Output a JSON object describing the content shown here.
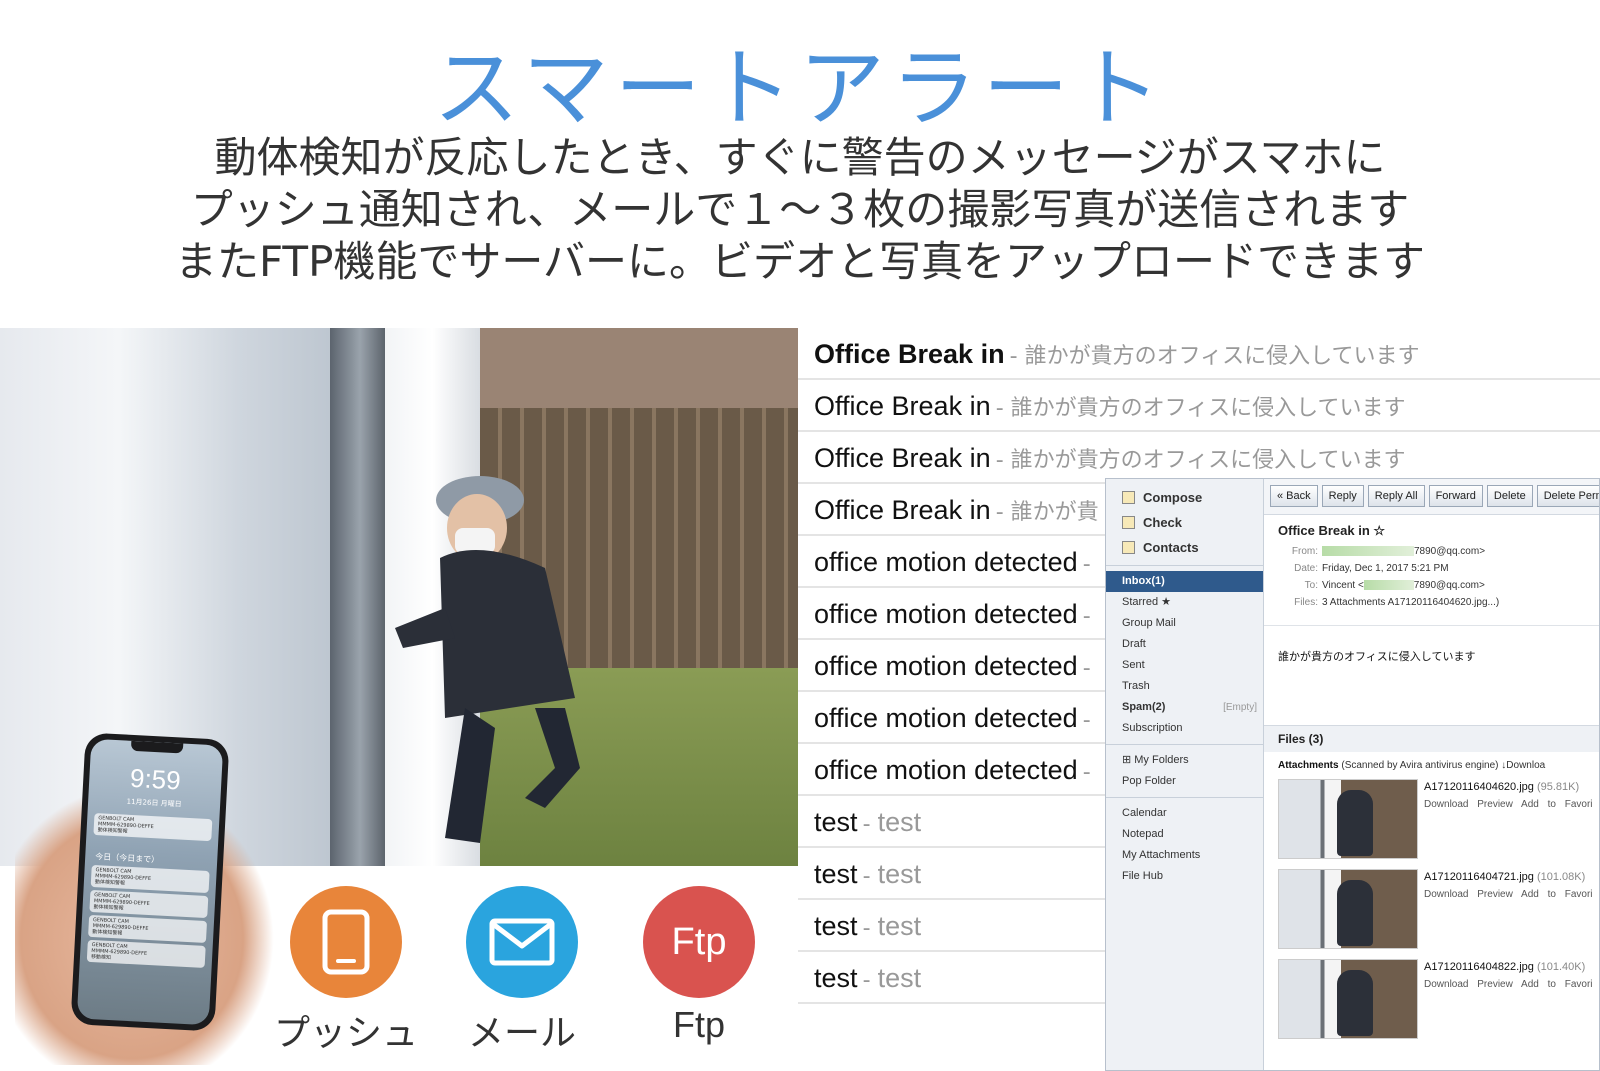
{
  "title": "スマートアラート",
  "description": [
    "動体検知が反応したとき、すぐに警告のメッセージがスマホに",
    "プッシュ通知され、メールで１～３枚の撮影写真が送信されます",
    "またFTP機能でサーバーに。ビデオと写真をアップロードできます"
  ],
  "phone": {
    "time": "9:59",
    "date": "11月26日 月曜日",
    "today_label": "今日（今日まで）",
    "notifications": [
      {
        "app": "GENBOLT CAM",
        "text": "MMMM-629890-DEFFE",
        "sub": "動体検知警報"
      },
      {
        "app": "GENBOLT CAM",
        "text": "MMMM-629890-DEFFE",
        "sub": "動体検知警報"
      },
      {
        "app": "GENBOLT CAM",
        "text": "MMMM-629890-DEFFE",
        "sub": "動体検知警報"
      },
      {
        "app": "GENBOLT CAM",
        "text": "MMMM-629890-DEFFE",
        "sub": "動体検知警報"
      },
      {
        "app": "GENBOLT CAM",
        "text": "MMMM-629890-DEFFE",
        "sub": "移動検知"
      }
    ]
  },
  "icons": {
    "push_label": "プッシュ",
    "mail_label": "メール",
    "ftp_label": "Ftp",
    "ftp_text": "Ftp"
  },
  "email_list": [
    {
      "subject": "Office Break in",
      "snippet": "誰かが貴方のオフィスに侵入しています",
      "bold": true
    },
    {
      "subject": "Office Break in",
      "snippet": "誰かが貴方のオフィスに侵入しています",
      "bold": false
    },
    {
      "subject": "Office Break in",
      "snippet": "誰かが貴方のオフィスに侵入しています",
      "bold": false
    },
    {
      "subject": "Office Break in",
      "snippet": "誰かが貴",
      "bold": false
    },
    {
      "subject": "office motion detected",
      "snippet": "",
      "bold": false
    },
    {
      "subject": "office motion detected",
      "snippet": "",
      "bold": false
    },
    {
      "subject": "office motion detected",
      "snippet": "",
      "bold": false
    },
    {
      "subject": "office motion detected",
      "snippet": "",
      "bold": false
    },
    {
      "subject": "office motion detected",
      "snippet": "",
      "bold": false
    },
    {
      "subject": "test",
      "snippet": "test",
      "bold": false
    },
    {
      "subject": "test",
      "snippet": "test",
      "bold": false
    },
    {
      "subject": "test",
      "snippet": "test",
      "bold": false
    },
    {
      "subject": "test",
      "snippet": "test",
      "bold": false
    }
  ],
  "webmail": {
    "actions": [
      {
        "label": "Compose",
        "icon": "compose-icon"
      },
      {
        "label": "Check",
        "icon": "check-icon"
      },
      {
        "label": "Contacts",
        "icon": "contacts-icon"
      }
    ],
    "folders_primary": [
      "Inbox(1)",
      "Starred ★",
      "Group Mail",
      "Draft",
      "Sent",
      "Trash",
      "Spam(2)",
      "Subscription"
    ],
    "spam_empty": "[Empty]",
    "folders_secondary": [
      "⊞ My Folders",
      "Pop Folder"
    ],
    "folders_tertiary": [
      "Calendar",
      "Notepad",
      "My Attachments",
      "File Hub"
    ],
    "toolbar": [
      "« Back",
      "Reply",
      "Reply All",
      "Forward",
      "Delete",
      "Delete Perm"
    ],
    "subject": "Office Break in ☆",
    "from_label": "From:",
    "from_value": "7890@qq.com>",
    "date_label": "Date:",
    "date_value": "Friday, Dec 1, 2017 5:21 PM",
    "to_label": "To:",
    "to_value": "Vincent <",
    "to_value2": "7890@qq.com>",
    "files_label": "Files:",
    "files_value": "3 Attachments  A17120116404620.jpg...)",
    "body": "誰かが貴方のオフィスに侵入しています",
    "files_header": "Files (3)",
    "attachments_header": "Attachments",
    "scan_note": "(Scanned by Avira antivirus engine)",
    "download_all": "↓Downloa",
    "attachments": [
      {
        "name": "A17120116404620.jpg",
        "size": "(95.81K)",
        "links": "Download Preview Add to Favori"
      },
      {
        "name": "A17120116404721.jpg",
        "size": "(101.08K)",
        "links": "Download Preview Add to Favori"
      },
      {
        "name": "A17120116404822.jpg",
        "size": "(101.40K)",
        "links": "Download Preview Add to Favori"
      }
    ]
  }
}
